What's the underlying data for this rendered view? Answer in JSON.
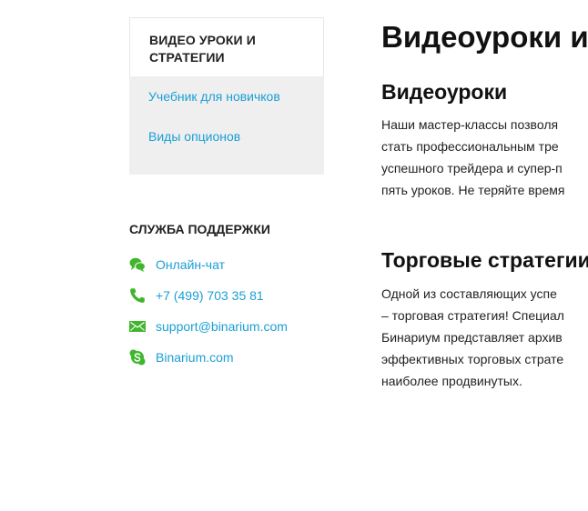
{
  "sidebar": {
    "heading": "ВИДЕО УРОКИ И СТРАТЕГИИ",
    "links": [
      "Учебник для новичков",
      "Виды опционов"
    ]
  },
  "support": {
    "title": "СЛУЖБА ПОДДЕРЖКИ",
    "contacts": [
      {
        "icon": "chat-icon",
        "label": "Онлайн-чат"
      },
      {
        "icon": "phone-icon",
        "label": "+7 (499) 703 35 81"
      },
      {
        "icon": "mail-icon",
        "label": "support@binarium.com"
      },
      {
        "icon": "skype-icon",
        "label": "Binarium.com"
      }
    ],
    "icon_color": "#3fb62b"
  },
  "main": {
    "title": "Видеоуроки и",
    "sections": [
      {
        "title": "Видеоуроки",
        "lines": [
          "Наши мастер-классы позволя",
          "стать профессиональным тре",
          "успешного трейдера и супер-п",
          "пять уроков. Не теряйте время"
        ]
      },
      {
        "title": "Торговые стратегии",
        "lines": [
          "Одной из составляющих успе",
          "– торговая стратегия! Специал",
          "Бинариум представляет архив",
          "эффективных торговых страте",
          "наиболее продвинутых."
        ]
      }
    ]
  },
  "colors": {
    "link": "#1a9fd4",
    "nav_bg": "#efefef",
    "text": "#222222"
  }
}
